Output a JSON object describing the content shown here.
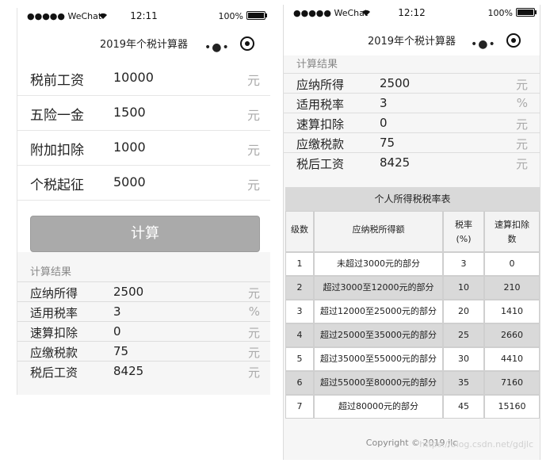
{
  "left": {
    "status": {
      "carrier": "●●●●● WeChat",
      "time": "12:11",
      "battery": "100%"
    },
    "nav_title": "2019年个税计算器",
    "fields": [
      {
        "label": "税前工资",
        "value": "10000",
        "unit": "元"
      },
      {
        "label": "五险一金",
        "value": "1500",
        "unit": "元"
      },
      {
        "label": "附加扣除",
        "value": "1000",
        "unit": "元"
      },
      {
        "label": "个税起征",
        "value": "5000",
        "unit": "元"
      }
    ],
    "calc_button": "计算",
    "result_title": "计算结果",
    "results": [
      {
        "label": "应纳所得",
        "value": "2500",
        "unit": "元"
      },
      {
        "label": "适用税率",
        "value": "3",
        "unit": "%"
      },
      {
        "label": "速算扣除",
        "value": "0",
        "unit": "元"
      },
      {
        "label": "应缴税款",
        "value": "75",
        "unit": "元"
      },
      {
        "label": "税后工资",
        "value": "8425",
        "unit": "元"
      }
    ]
  },
  "right": {
    "status": {
      "carrier": "●●●●● WeChat",
      "time": "12:12",
      "battery": "100%"
    },
    "nav_title": "2019年个税计算器",
    "result_title": "计算结果",
    "results": [
      {
        "label": "应纳所得",
        "value": "2500",
        "unit": "元"
      },
      {
        "label": "适用税率",
        "value": "3",
        "unit": "%"
      },
      {
        "label": "速算扣除",
        "value": "0",
        "unit": "元"
      },
      {
        "label": "应缴税款",
        "value": "75",
        "unit": "元"
      },
      {
        "label": "税后工资",
        "value": "8425",
        "unit": "元"
      }
    ],
    "table": {
      "title": "个人所得税税率表",
      "headers": [
        "级数",
        "应纳税所得额",
        "税率\n(%)",
        "速算扣除\n数"
      ],
      "rows": [
        [
          "1",
          "未超过3000元的部分",
          "3",
          "0"
        ],
        [
          "2",
          "超过3000至12000元的部分",
          "10",
          "210"
        ],
        [
          "3",
          "超过12000至25000元的部分",
          "20",
          "1410"
        ],
        [
          "4",
          "超过25000至35000元的部分",
          "25",
          "2660"
        ],
        [
          "5",
          "超过35000至55000元的部分",
          "30",
          "4410"
        ],
        [
          "6",
          "超过55000至80000元的部分",
          "35",
          "7160"
        ],
        [
          "7",
          "超过80000元的部分",
          "45",
          "15160"
        ]
      ]
    },
    "copyright": "Copyright © 2019 jlc",
    "watermark": "https://blog.csdn.net/gdjlc"
  }
}
